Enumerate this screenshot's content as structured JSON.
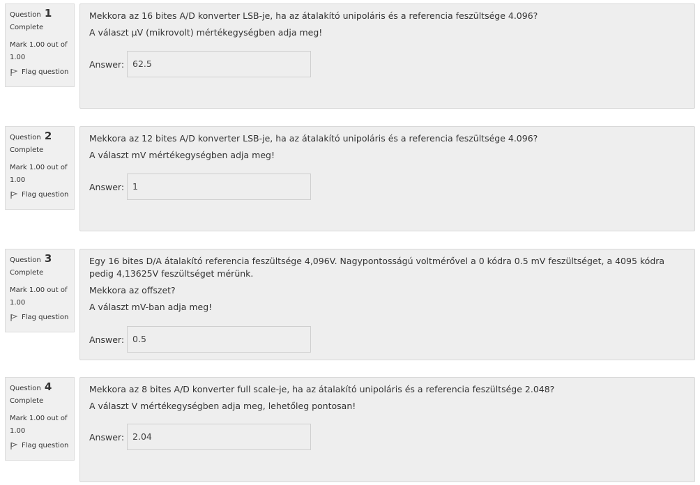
{
  "questions": [
    {
      "label": "Question",
      "number": "1",
      "state": "Complete",
      "grade": "Mark 1.00 out of 1.00",
      "flag_label": "Flag question",
      "text": [
        "Mekkora az 16 bites A/D konverter LSB-je, ha az átalakító unipoláris és a referencia feszültsége 4.096?",
        "A választ µV  (mikrovolt) mértékegységben adja meg!"
      ],
      "answer_label": "Answer:",
      "answer_value": "62.5"
    },
    {
      "label": "Question",
      "number": "2",
      "state": "Complete",
      "grade": "Mark 1.00 out of 1.00",
      "flag_label": "Flag question",
      "text": [
        "Mekkora az 12 bites A/D konverter LSB-je, ha az átalakító unipoláris és a referencia feszültsége 4.096?",
        "A választ mV mértékegységben adja meg!"
      ],
      "answer_label": "Answer:",
      "answer_value": "1"
    },
    {
      "label": "Question",
      "number": "3",
      "state": "Complete",
      "grade": "Mark 1.00 out of 1.00",
      "flag_label": "Flag question",
      "text": [
        "Egy 16 bites D/A átalakító referencia feszültsége 4,096V.  Nagypontosságú voltmérővel a 0 kódra 0.5 mV feszültséget, a 4095 kódra pedig 4,13625V feszültséget mérünk.",
        "Mekkora az offszet?",
        "A választ mV-ban adja meg!"
      ],
      "answer_label": "Answer:",
      "answer_value": "0.5"
    },
    {
      "label": "Question",
      "number": "4",
      "state": "Complete",
      "grade": "Mark 1.00 out of 1.00",
      "flag_label": "Flag question",
      "text": [
        "Mekkora az 8 bites A/D konverter full scale-je, ha az átalakító unipoláris és a referencia feszültsége 2.048?",
        "A választ V mértékegységben adja meg, lehetőleg pontosan!"
      ],
      "answer_label": "Answer:",
      "answer_value": "2.04"
    }
  ]
}
